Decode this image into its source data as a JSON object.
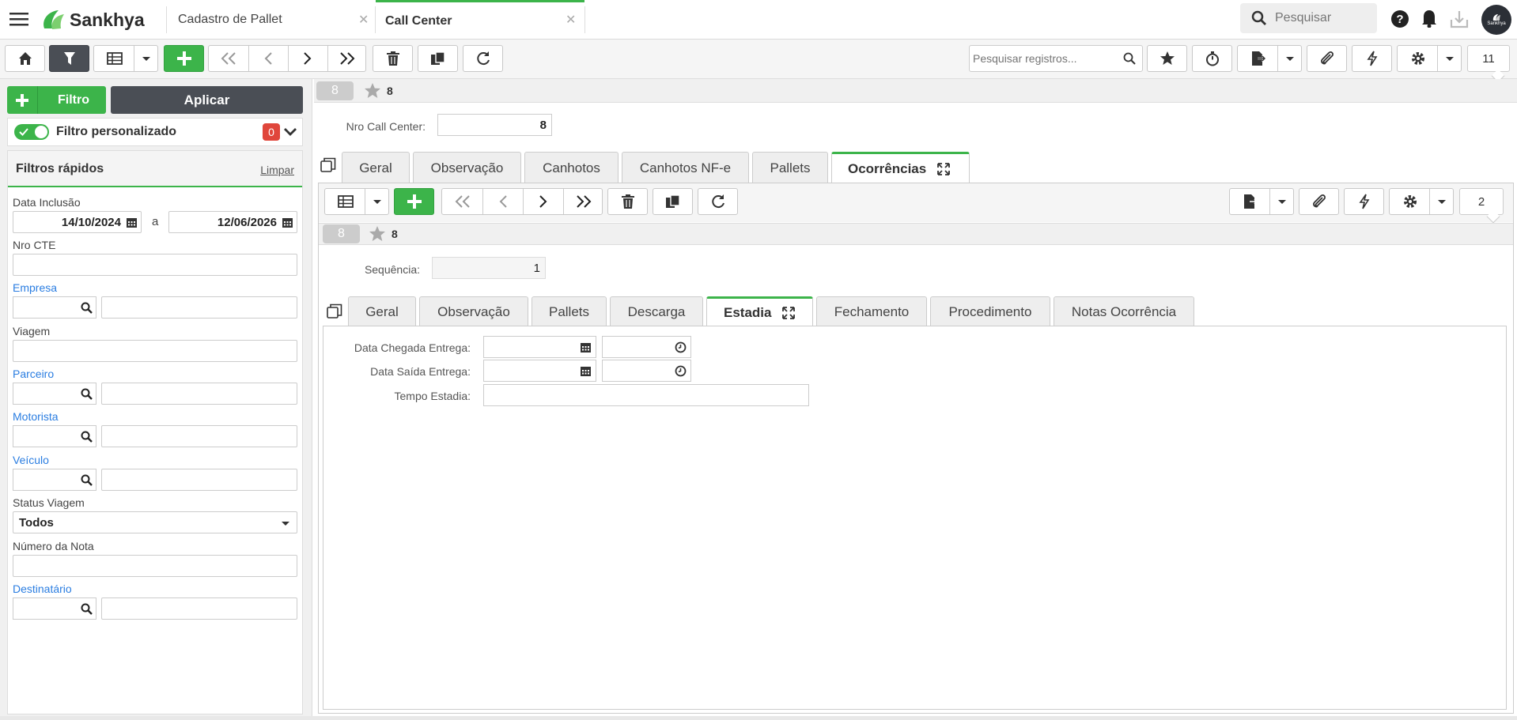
{
  "app": {
    "brand": "Sankhya",
    "avatar_text": "Sankhya"
  },
  "tabs": [
    {
      "label": "Cadastro de Pallet",
      "active": false
    },
    {
      "label": "Call Center",
      "active": true
    }
  ],
  "search": {
    "placeholder": "Pesquisar"
  },
  "toolbar": {
    "search_placeholder": "Pesquisar registros...",
    "count": "11"
  },
  "filter": {
    "filtro_label": "Filtro",
    "aplicar_label": "Aplicar",
    "personalizado_label": "Filtro personalizado",
    "personalizado_count": "0",
    "quick_title": "Filtros rápidos",
    "limpar": "Limpar",
    "data_inclusao_label": "Data Inclusão",
    "data_from": "14/10/2024",
    "data_sep": "a",
    "data_to": "12/06/2026",
    "nro_cte_label": "Nro CTE",
    "empresa_label": "Empresa",
    "viagem_label": "Viagem",
    "parceiro_label": "Parceiro",
    "motorista_label": "Motorista",
    "veiculo_label": "Veículo",
    "status_viagem_label": "Status Viagem",
    "status_viagem_value": "Todos",
    "numero_nota_label": "Número da Nota",
    "destinatario_label": "Destinatário"
  },
  "record": {
    "badge": "8",
    "fav_value": "8",
    "nro_label": "Nro Call Center:",
    "nro_value": "8"
  },
  "main_tabs": [
    "Geral",
    "Observação",
    "Canhotos",
    "Canhotos NF-e",
    "Pallets",
    "Ocorrências"
  ],
  "sub": {
    "count": "2",
    "badge": "8",
    "fav_value": "8",
    "seq_label": "Sequência:",
    "seq_value": "1"
  },
  "sub_tabs": [
    "Geral",
    "Observação",
    "Pallets",
    "Descarga",
    "Estadia",
    "Fechamento",
    "Procedimento",
    "Notas Ocorrência"
  ],
  "estadia": {
    "chegada_label": "Data Chegada Entrega:",
    "saida_label": "Data Saída Entrega:",
    "tempo_label": "Tempo Estadia:"
  },
  "colors": {
    "accent": "#3cb44a",
    "dark": "#4a4e55",
    "link": "#2a7de1",
    "danger": "#e0463b"
  }
}
